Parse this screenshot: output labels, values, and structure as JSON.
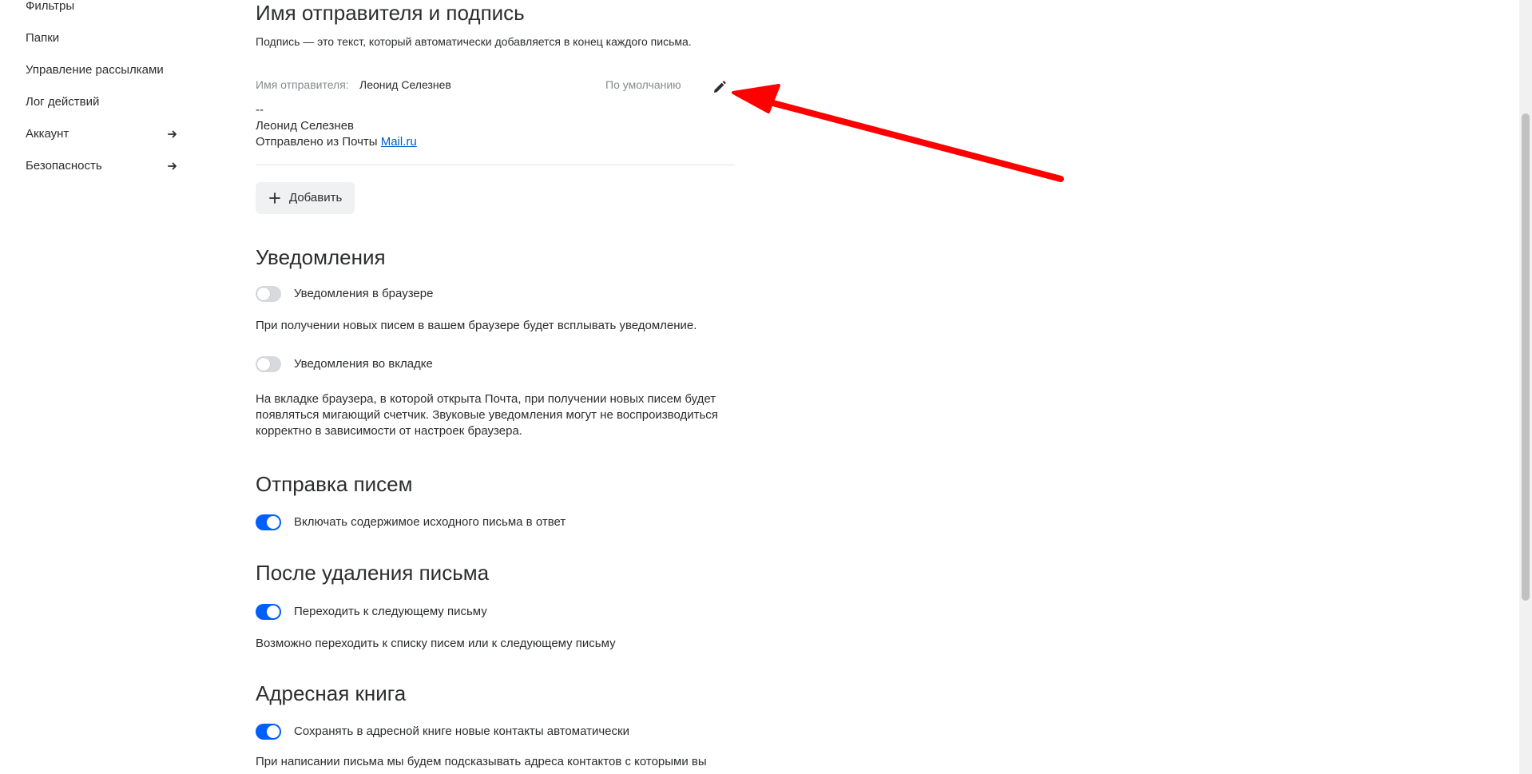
{
  "sidebar": {
    "items": [
      {
        "label": "Фильтры"
      },
      {
        "label": "Папки"
      },
      {
        "label": "Управление рассылками"
      },
      {
        "label": "Лог действий"
      },
      {
        "label": "Аккаунт",
        "has_arrow": true
      },
      {
        "label": "Безопасность",
        "has_arrow": true
      }
    ]
  },
  "signature": {
    "heading": "Имя отправителя и подпись",
    "description": "Подпись — это текст, который автоматически добавляется в конец каждого письма.",
    "sender_label": "Имя отправителя:",
    "sender_name": "Леонид Селезнев",
    "default_badge": "По умолчанию",
    "edit_icon": "pencil-icon",
    "sig_dashes": "--",
    "sig_name": "Леонид Селезнев",
    "sig_sent_prefix": "Отправлено из Почты",
    "sig_link": "Mail.ru",
    "add_button": "Добавить"
  },
  "notifications": {
    "heading": "Уведомления",
    "browser_toggle": {
      "label": "Уведомления в браузере",
      "on": false
    },
    "browser_desc": "При получении новых писем в вашем браузере будет всплывать уведомление.",
    "tab_toggle": {
      "label": "Уведомления во вкладке",
      "on": false
    },
    "tab_desc_1": "На вкладке браузера, в которой открыта Почта, при получении новых писем будет",
    "tab_desc_2": "появляться мигающий счетчик. Звуковые уведомления могут не воспроизводиться",
    "tab_desc_3": "корректно в зависимости от настроек браузера."
  },
  "sending": {
    "heading": "Отправка писем",
    "quote_toggle": {
      "label": "Включать содержимое исходного письма в ответ",
      "on": true
    }
  },
  "after_delete": {
    "heading": "После удаления письма",
    "next_toggle": {
      "label": "Переходить к следующему письму",
      "on": true
    },
    "desc": "Возможно переходить к списку писем или к следующему письму"
  },
  "address_book": {
    "heading": "Адресная книга",
    "autosave_toggle": {
      "label": "Сохранять в адресной книге новые контакты автоматически",
      "on": true
    },
    "desc": "При написании письма мы будем подсказывать адреса контактов с которыми вы"
  },
  "colors": {
    "accent": "#005ff9",
    "annotation_arrow": "#ff0000",
    "link": "#005bd1"
  }
}
